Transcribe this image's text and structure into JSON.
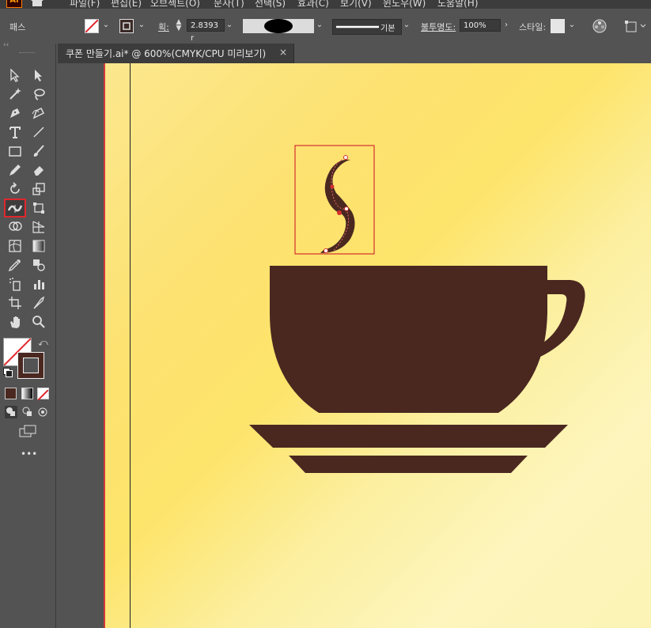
{
  "app": {
    "logo": "Ai"
  },
  "menu": [
    "파일(F)",
    "편집(E)",
    "오브젝트(O)",
    "문자(T)",
    "선택(S)",
    "효과(C)",
    "보기(V)",
    "윈도우(W)",
    "도움말(H)"
  ],
  "control_bar": {
    "selection_label": "패스",
    "stroke_label": "획:",
    "stroke_weight": "2.8393 r",
    "line_style_label": "기본",
    "opacity_label": "불투명도:",
    "opacity_value": "100%",
    "style_label": "스타일:",
    "colors": {
      "stroke": "#4a2820",
      "accent_red": "#e0272d"
    }
  },
  "document_tab": {
    "title": "쿠폰 만들기.ai* @ 600%(CMYK/CPU 미리보기)",
    "close": "×"
  },
  "tools": {
    "active_tool": "width-tool",
    "more_label": "•••"
  },
  "artwork": {
    "cup_color": "#4a2820",
    "background_colors": [
      "#fde271",
      "#fcf3b5"
    ],
    "selection_color": "#d32f2f"
  }
}
